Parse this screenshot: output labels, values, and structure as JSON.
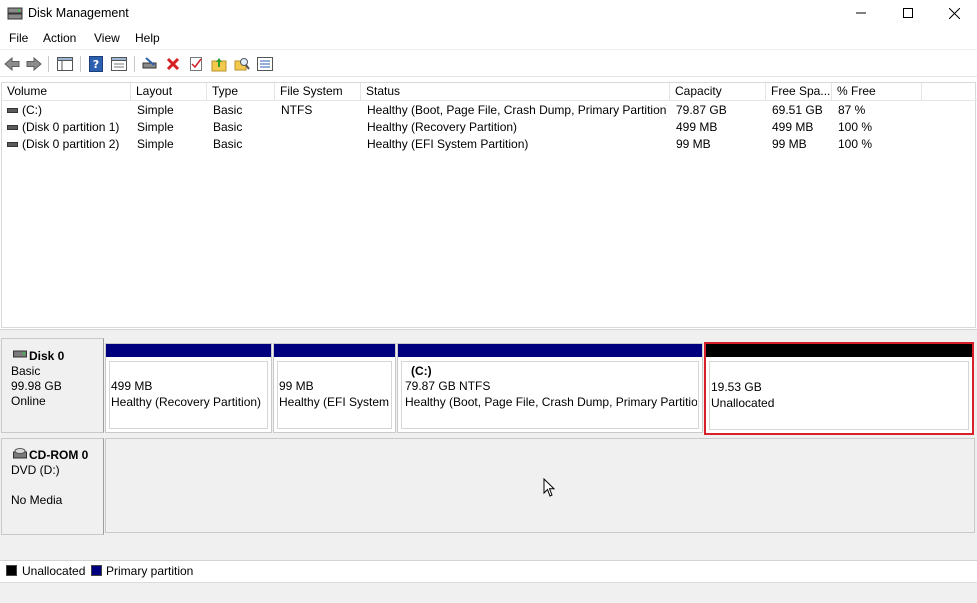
{
  "window": {
    "title": "Disk Management"
  },
  "menu": [
    "File",
    "Action",
    "View",
    "Help"
  ],
  "colors": {
    "primary_partition": "#00007f",
    "unallocated": "#000000",
    "selection_outline": "#d9202a"
  },
  "volume_list": {
    "columns": [
      "Volume",
      "Layout",
      "Type",
      "File System",
      "Status",
      "Capacity",
      "Free Spa...",
      "% Free"
    ],
    "rows": [
      [
        "(C:)",
        "Simple",
        "Basic",
        "NTFS",
        "Healthy (Boot, Page File, Crash Dump, Primary Partition)",
        "79.87 GB",
        "69.51 GB",
        "87 %"
      ],
      [
        "(Disk 0 partition 1)",
        "Simple",
        "Basic",
        "",
        "Healthy (Recovery Partition)",
        "499 MB",
        "499 MB",
        "100 %"
      ],
      [
        "(Disk 0 partition 2)",
        "Simple",
        "Basic",
        "",
        "Healthy (EFI System Partition)",
        "99 MB",
        "99 MB",
        "100 %"
      ]
    ]
  },
  "disk0": {
    "name": "Disk 0",
    "type": "Basic",
    "size": "99.98 GB",
    "state": "Online",
    "partitions": [
      {
        "title": "",
        "size": "499 MB",
        "status": "Healthy (Recovery Partition)",
        "kind": "primary"
      },
      {
        "title": "",
        "size": "99 MB",
        "status": "Healthy (EFI System",
        "kind": "primary"
      },
      {
        "title": "(C:)",
        "size": "79.87 GB NTFS",
        "status": "Healthy (Boot, Page File, Crash Dump, Primary Partitior",
        "kind": "primary"
      },
      {
        "title": "",
        "size": "19.53 GB",
        "status": "Unallocated",
        "kind": "unallocated"
      }
    ]
  },
  "cdrom0": {
    "name": "CD-ROM 0",
    "drive": "DVD (D:)",
    "media": "No Media"
  },
  "legend": [
    {
      "label": "Unallocated",
      "color": "#000000"
    },
    {
      "label": "Primary partition",
      "color": "#00007f"
    }
  ]
}
